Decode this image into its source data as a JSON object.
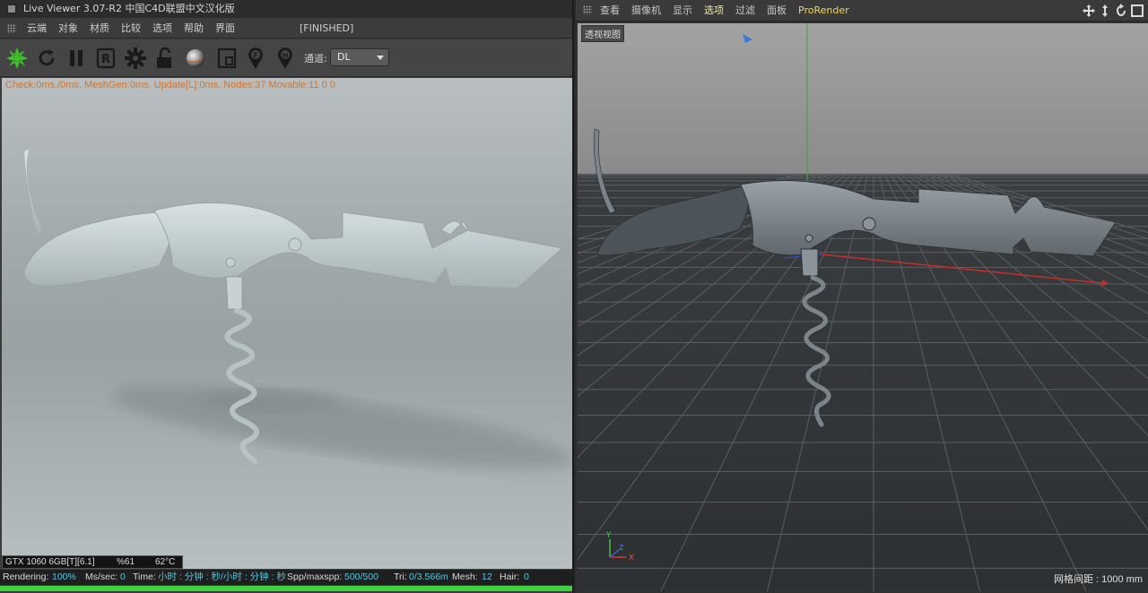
{
  "live_viewer": {
    "title": "Live Viewer 3.07-R2 中国C4D联盟中文汉化版",
    "menu": [
      "云端",
      "对象",
      "材质",
      "比较",
      "选项",
      "帮助",
      "界面"
    ],
    "render_state": "[FINISHED]",
    "toolbar_icons": [
      "octane-logo-icon",
      "refresh-icon",
      "pause-icon",
      "r-icon",
      "gear-icon",
      "unlock-icon",
      "material-sphere-icon",
      "region-icon",
      "pin-f-icon",
      "pin-m-icon"
    ],
    "channel_label": "通道:",
    "channel_value": "DL",
    "check_line": "Check:0ms./0ms. MeshGen:0ms. Update[L]:0ms. Nodes:37 Movable:11  0 0",
    "gpu": {
      "name": "GTX 1060 6GB[T][6.1]",
      "usage": "%61",
      "temp": "62°C"
    },
    "status": {
      "rendering_label": "Rendering:",
      "rendering_value": "100%",
      "ms_label": "Ms/sec:",
      "ms_value": "0",
      "time_label": "Time:",
      "time_value": "小时 : 分钟 : 秒/小时 : 分钟 : 秒",
      "spp_label": "Spp/maxspp:",
      "spp_value": "500/500",
      "tri_label": "Tri:",
      "tri_value": "0/3.566m",
      "mesh_label": "Mesh:",
      "mesh_value": "12",
      "hair_label": "Hair:",
      "hair_value": "0"
    },
    "progress": 1.0,
    "colors": {
      "progress": "#3ed23e",
      "check_text": "#d4742a",
      "status_value": "#56c7e0"
    }
  },
  "viewport": {
    "menu": [
      "查看",
      "摄像机",
      "显示",
      "选项",
      "过滤",
      "面板",
      "ProRender"
    ],
    "active_menu": "选项",
    "nav_icons": [
      "move-view-icon",
      "up-down-icon",
      "rotate-view-icon",
      "maximize-icon"
    ],
    "view_tag": "透视视图",
    "axis": {
      "x": "X",
      "y": "Y",
      "z": "Z"
    },
    "grid_spacing": "网格间距 : 1000 mm"
  }
}
